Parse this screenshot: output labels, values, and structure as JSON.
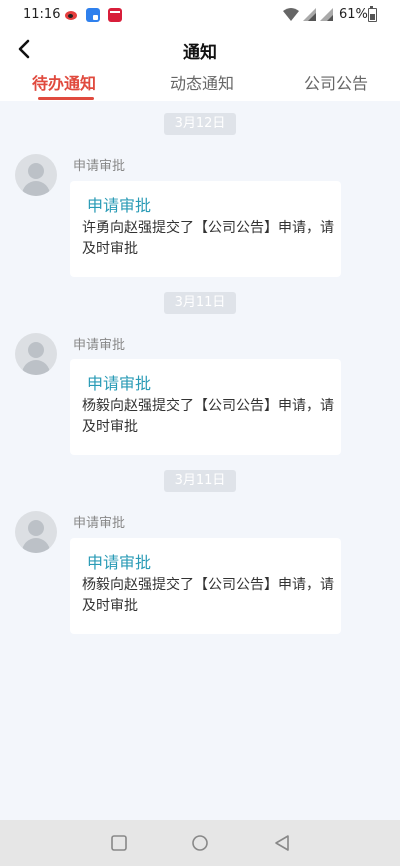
{
  "status_bar": {
    "time": "11:16",
    "battery": "61%"
  },
  "header": {
    "title": "通知"
  },
  "tabs": [
    {
      "label": "待办通知",
      "active": true
    },
    {
      "label": "动态通知",
      "active": false
    },
    {
      "label": "公司公告",
      "active": false
    }
  ],
  "messages": [
    {
      "date": "3月12日",
      "sender": "申请审批",
      "card_title": "申请审批",
      "body": "许勇向赵强提交了【公司公告】申请，请及时审批"
    },
    {
      "date": "3月11日",
      "sender": "申请审批",
      "card_title": "申请审批",
      "body": "杨毅向赵强提交了【公司公告】申请，请及时审批"
    },
    {
      "date": "3月11日",
      "sender": "申请审批",
      "card_title": "申请审批",
      "body": "杨毅向赵强提交了【公司公告】申请，请及时审批"
    }
  ],
  "colors": {
    "accent": "#e04a3e",
    "card_title": "#2a9bb6",
    "background": "#f3f6fb"
  },
  "icons": [
    "back-arrow-icon",
    "avatar-placeholder-icon",
    "nav-recents-icon",
    "nav-home-icon",
    "nav-back-icon"
  ]
}
